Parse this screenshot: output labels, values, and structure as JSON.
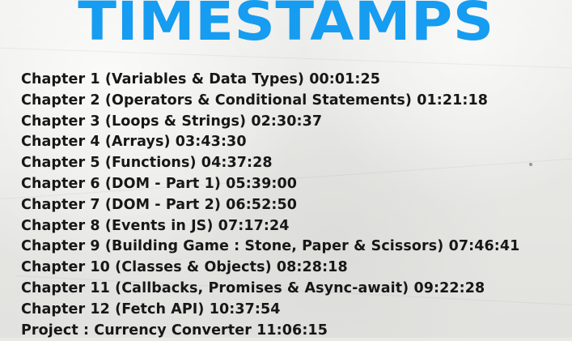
{
  "heading": {
    "title": "TIMESTAMPS"
  },
  "timestamps": [
    {
      "text": "Chapter 1 (Variables & Data Types) 00:01:25"
    },
    {
      "text": "Chapter 2 (Operators & Conditional Statements) 01:21:18"
    },
    {
      "text": "Chapter 3 (Loops & Strings) 02:30:37"
    },
    {
      "text": "Chapter 4 (Arrays) 03:43:30"
    },
    {
      "text": "Chapter 5 (Functions) 04:37:28"
    },
    {
      "text": "Chapter 6 (DOM - Part 1) 05:39:00"
    },
    {
      "text": "Chapter 7 (DOM - Part 2) 06:52:50"
    },
    {
      "text": "Chapter 8 (Events in JS) 07:17:24"
    },
    {
      "text": "Chapter 9 (Building Game : Stone, Paper & Scissors) 07:46:41"
    },
    {
      "text": "Chapter 10 (Classes & Objects) 08:28:18"
    },
    {
      "text": "Chapter 11 (Callbacks, Promises & Async-await) 09:22:28"
    },
    {
      "text": "Chapter 12 (Fetch API) 10:37:54"
    },
    {
      "text": "Project : Currency Converter 11:06:15"
    }
  ],
  "colors": {
    "title": "#169cf0",
    "text": "#171717",
    "background": "#e9e9e7"
  }
}
